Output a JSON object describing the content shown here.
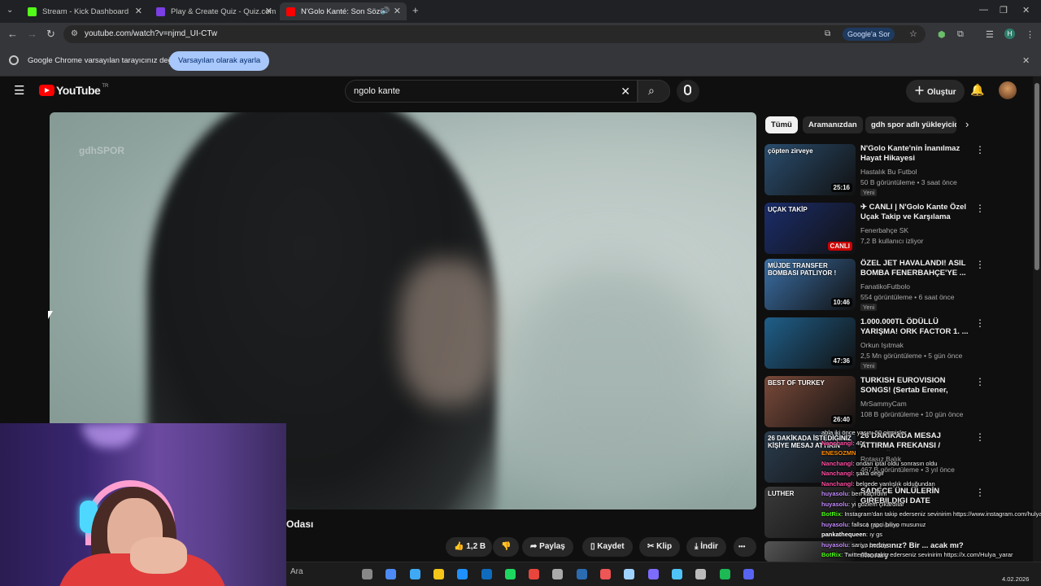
{
  "chrome": {
    "tabs": [
      {
        "label": "Stream - Kick Dashboard",
        "favicon_color": "#53fc18"
      },
      {
        "label": "Play & Create Quiz - Quiz.com",
        "favicon_color": "#7b3fe4"
      },
      {
        "label": "N'Golo Kanté: Son Sözüm F",
        "favicon_color": "#ff0000"
      }
    ],
    "new_tab": "+",
    "url": "youtube.com/watch?v=njmd_UI-CTw",
    "google_button": "Google'a Sor",
    "profile_initial": "H",
    "infobar_text": "Google Chrome varsayılan tarayıcınız değil",
    "infobar_button": "Varsayılan olarak ayarla"
  },
  "youtube": {
    "logo_text": "YouTube",
    "country_code": "TR",
    "search_query": "ngolo kante",
    "create_label": "Oluştur",
    "watermark": "gdhSPOR",
    "title_fragment": "Odası",
    "actions": {
      "likes": "1,2 B",
      "share": "Paylaş",
      "save": "Kaydet",
      "clip": "Klip",
      "download": "İndir",
      "more": "•••"
    },
    "chips": [
      "Tümü",
      "Aramanızdan",
      "gdh spor adlı yükleyicide"
    ],
    "recommendations": [
      {
        "title": "N'Golo Kante'nin İnanılmaz Hayat Hikayesi",
        "channel": "Hastalık Bu Futbol",
        "meta": "50 B görüntüleme • 3 saat önce",
        "badge": "Yeni",
        "duration": "25:16",
        "thumb_color": "#2a4d6e",
        "thumb_text": "çöpten zirveye"
      },
      {
        "title": "✈ CANLI | N'Golo Kante Özel Uçak Takip ve Karşılama Yayını",
        "channel": "Fenerbahçe SK",
        "meta": "7,2 B kullanıcı izliyor",
        "badge": "",
        "duration": "CANLI",
        "thumb_color": "#1b2d6b",
        "thumb_text": "UÇAK TAKİP"
      },
      {
        "title": "ÖZEL JET HAVALANDI! ASIL BOMBA FENERBAHÇE'YE ...",
        "channel": "FanatikoFutbolo",
        "meta": "554 görüntüleme • 6 saat önce",
        "badge": "Yeni",
        "duration": "10:46",
        "thumb_color": "#3b6fa6",
        "thumb_text": "MÜJDE TRANSFER BOMBASI PATLIYOR !"
      },
      {
        "title": "1.000.000TL ÖDÜLLÜ YARIŞMA! ORK FACTOR 1. ...",
        "channel": "Orkun Işıtmak",
        "meta": "2,5 Mn görüntüleme • 5 gün önce",
        "badge": "Yeni",
        "duration": "47:36",
        "thumb_color": "#1f5f8a",
        "thumb_text": ""
      },
      {
        "title": "TURKISH EUROVISION SONGS! (Sertab Erener, Athena, Hadise...",
        "channel": "MrSammyCam",
        "meta": "108 B görüntüleme • 10 gün önce",
        "badge": "",
        "duration": "26:40",
        "thumb_color": "#7a4a3a",
        "thumb_text": "BEST OF TURKEY"
      },
      {
        "title": "26 DAKİKADA MESAJ ATTIRMA FREKANSI / İSTEDİĞİNİZ KİŞİ...",
        "channel": "Rotasız Balık",
        "meta": "467 B görüntüleme • 3 yıl önce",
        "badge": "",
        "duration": "",
        "thumb_color": "#2b3d4f",
        "thumb_text": "26 DAKİKADA İSTEDİĞİNİZ KİŞİYE MESAJ ATTIRIN"
      },
      {
        "title": "SADECE ÜNLÜLERİN GIREBILDIGI DATE",
        "channel": "",
        "meta": "• 4 gün önce",
        "badge": "",
        "duration": "",
        "thumb_color": "#3a3a3a",
        "thumb_text": "LUTHER"
      },
      {
        "title": "... mdasınız? Bir ... acak mı? #horary",
        "channel": "",
        "meta": "",
        "badge": "",
        "duration": "",
        "thumb_color": "#555",
        "thumb_text": ""
      }
    ]
  },
  "chat": [
    {
      "user": "",
      "text": "abla iki önce yaşını 50 girmişler",
      "color": "#ffffff"
    },
    {
      "user": "Nanchangl",
      "text": ": 40*",
      "color": "#ff4fa3"
    },
    {
      "user": "ENESOZMN",
      "text": "",
      "color": "#ff8c00"
    },
    {
      "user": "Nanchangl",
      "text": ": ondan iptal oldu sonrasın oldu",
      "color": "#ff4fa3"
    },
    {
      "user": "Nanchangl",
      "text": ": şaka değil",
      "color": "#ff4fa3"
    },
    {
      "user": "Nanchangl",
      "text": ": belgede yanlışlık olduğundan",
      "color": "#ff4fa3"
    },
    {
      "user": "huyasolu",
      "text": ": ben kaçırdım",
      "color": "#c58bff"
    },
    {
      "user": "huyasolu",
      "text": ": yi gözlem çıkardılar",
      "color": "#c58bff"
    },
    {
      "user": "BotRix",
      "text": ": Instagram'dan takip ederseniz sevinirim https://www.instagram.com/hulyayarar/",
      "color": "#53fc18"
    },
    {
      "user": "huyasolu",
      "text": ": fallsca rapci biliyo musunuz",
      "color": "#c58bff"
    },
    {
      "user": "pankathequeen",
      "text": ": ıy gs",
      "color": "#ffffff"
    },
    {
      "user": "huyasolu",
      "text": ": sariya benziyo",
      "color": "#c58bff"
    },
    {
      "user": "BotRix",
      "text": ": Twitter'dan takip ederseniz sevinirim https://x.com/Hulya_yarar",
      "color": "#53fc18"
    },
    {
      "user": "huyasolu",
      "text": ": ucuz olmuş",
      "color": "#c58bff"
    }
  ],
  "taskbar": {
    "search_label": "Ara",
    "date": "4.02.2026",
    "apps": [
      "#888",
      "#4c8bf5",
      "#3fa9f5",
      "#f5c518",
      "#1e90ff",
      "#0f6cbd",
      "#1ed760",
      "#e8453c",
      "#aaa",
      "#2b6cb0",
      "#e55",
      "#9fd3ff",
      "#7c6cff",
      "#4fc3f7",
      "#bbb",
      "#1db954",
      "#5865f2"
    ]
  }
}
